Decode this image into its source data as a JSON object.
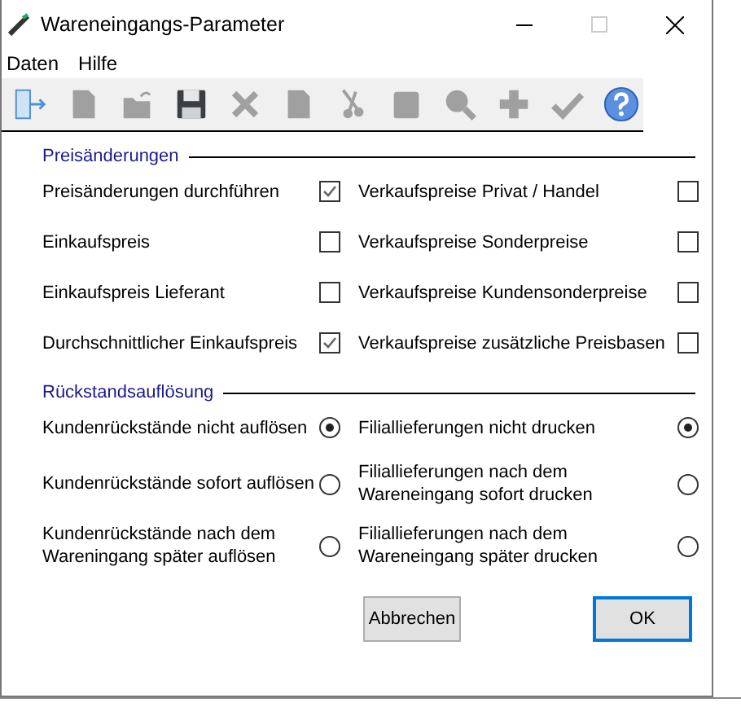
{
  "window": {
    "title": "Wareneingangs-Parameter"
  },
  "menu": [
    {
      "label": "Daten"
    },
    {
      "label": "Hilfe"
    }
  ],
  "toolbar": [
    {
      "kind": "exit",
      "disabled": false
    },
    {
      "kind": "new",
      "disabled": true
    },
    {
      "kind": "open",
      "disabled": true
    },
    {
      "kind": "save",
      "disabled": false
    },
    {
      "kind": "delete",
      "disabled": true
    },
    {
      "kind": "copy",
      "disabled": true
    },
    {
      "kind": "cut",
      "disabled": true
    },
    {
      "kind": "paste",
      "disabled": true
    },
    {
      "kind": "search",
      "disabled": true
    },
    {
      "kind": "add",
      "disabled": true
    },
    {
      "kind": "confirm",
      "disabled": true
    },
    {
      "kind": "help",
      "disabled": false
    }
  ],
  "price_changes": {
    "title": "Preisänderungen",
    "options": [
      {
        "label": "Preisänderungen durchführen",
        "checked": true
      },
      {
        "label": "Verkaufspreise Privat / Handel",
        "checked": false
      },
      {
        "label": "Einkaufspreis",
        "checked": false
      },
      {
        "label": "Verkaufspreise Sonderpreise",
        "checked": false
      },
      {
        "label": "Einkaufspreis Lieferant",
        "checked": false
      },
      {
        "label": "Verkaufspreise Kundensonderpreise",
        "checked": false
      },
      {
        "label": "Durchschnittlicher Einkaufspreis",
        "checked": true
      },
      {
        "label": "Verkaufspreise zusätzliche Preisbasen",
        "checked": false
      }
    ]
  },
  "backlog": {
    "title": "Rückstandsauflösung",
    "customer_options": [
      {
        "label": "Kundenrückstände nicht auflösen",
        "selected": true
      },
      {
        "label": "Kundenrückstände sofort auflösen",
        "selected": false
      },
      {
        "label": "Kundenrückstände nach dem Wareningang später auflösen",
        "selected": false
      }
    ],
    "branch_options": [
      {
        "label": "Filiallieferungen nicht drucken",
        "selected": true
      },
      {
        "label": "Filiallieferungen nach dem Wareneingang sofort drucken",
        "selected": false
      },
      {
        "label": "Filiallieferungen nach dem Wareneingang später drucken",
        "selected": false
      }
    ]
  },
  "buttons": [
    {
      "label": "Abbrechen",
      "default": false
    },
    {
      "label": "OK",
      "default": true
    }
  ]
}
